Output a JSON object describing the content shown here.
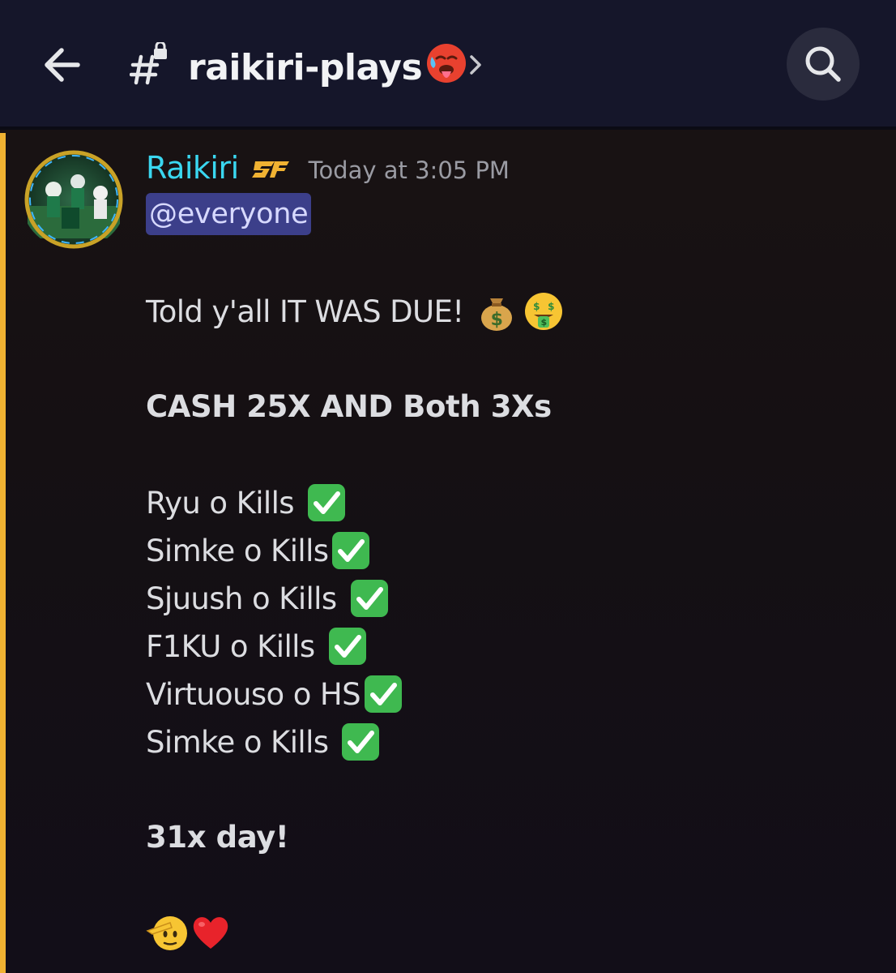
{
  "header": {
    "channel_name": "raikiri-plays",
    "channel_emoji": "hot-face-emoji",
    "back_icon": "arrow-left-icon",
    "channel_icon": "hash-lock-icon",
    "chevron_icon": "chevron-right-icon",
    "search_icon": "search-icon"
  },
  "message": {
    "author": "Raikiri",
    "author_badge": "server-tag-badge",
    "timestamp": "Today at 3:05 PM",
    "mention": "@everyone",
    "lines": [
      {
        "text": "Told y'all IT WAS DUE!",
        "emojis": [
          "money-bag-emoji",
          "money-mouth-face-emoji"
        ]
      },
      {
        "text": "CASH 25X AND Both 3Xs",
        "bold": true
      },
      {
        "text": "Ryu o Kills",
        "emojis": [
          "check-mark-button-emoji"
        ]
      },
      {
        "text": "Simke o Kills",
        "emojis": [
          "check-mark-button-emoji"
        ]
      },
      {
        "text": "Sjuush o Kills",
        "emojis": [
          "check-mark-button-emoji"
        ]
      },
      {
        "text": "F1KU o Kills",
        "emojis": [
          "check-mark-button-emoji"
        ]
      },
      {
        "text": "Virtuouso o HS",
        "emojis": [
          "check-mark-button-emoji"
        ]
      },
      {
        "text": "Simke o Kills",
        "emojis": [
          "check-mark-button-emoji"
        ]
      },
      {
        "text": "31x day!",
        "bold": true
      },
      {
        "text": "",
        "emojis": [
          "saluting-face-emoji",
          "red-heart-emoji"
        ]
      }
    ]
  },
  "colors": {
    "header_bg": "#15162a",
    "message_bg": "#151013",
    "author": "#3ad7f0",
    "mention_bg": "#3c3f8a",
    "mention_text": "#d7d9ff",
    "timestamp": "#9a9ba3",
    "text": "#dcdde1",
    "highlight_bar": "#f0b232",
    "check": "#3fb950"
  }
}
